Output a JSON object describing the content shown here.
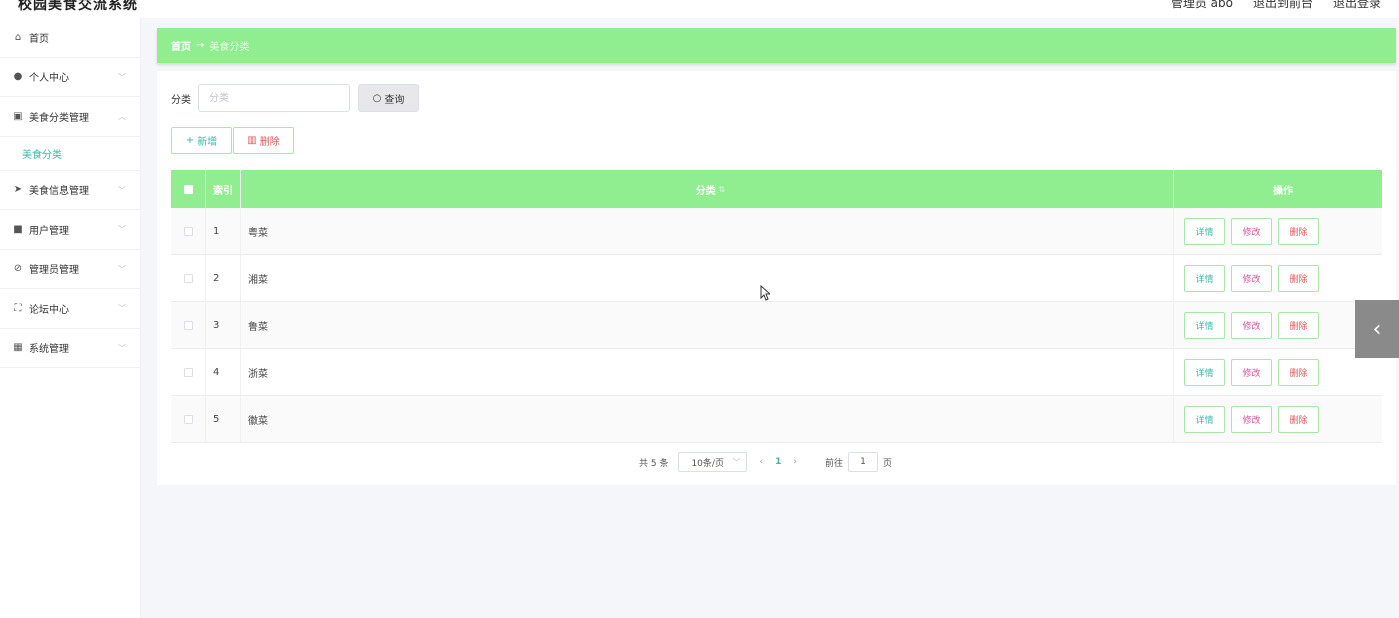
{
  "header": {
    "app_title": "校园美食交流系统",
    "admin_label": "管理员 abo",
    "back_to_front": "退出到前台",
    "logout": "退出登录"
  },
  "sidebar": {
    "items": [
      {
        "label": "首页",
        "icon": "home-icon"
      },
      {
        "label": "个人中心",
        "icon": "user-icon"
      },
      {
        "label": "美食分类管理",
        "icon": "clipboard-icon"
      },
      {
        "label": "美食信息管理",
        "icon": "send-icon"
      },
      {
        "label": "用户管理",
        "icon": "users-icon"
      },
      {
        "label": "管理员管理",
        "icon": "help-circle-icon"
      },
      {
        "label": "论坛中心",
        "icon": "frame-icon"
      },
      {
        "label": "系统管理",
        "icon": "grid-icon"
      }
    ],
    "active_sub": "美食分类"
  },
  "breadcrumb": {
    "home": "首页",
    "arrow": "→",
    "current": "美食分类"
  },
  "search": {
    "label": "分类",
    "placeholder": "分类",
    "query_label": "查询"
  },
  "actions": {
    "add_label": "新增",
    "delete_label": "删除"
  },
  "table": {
    "headers": {
      "index": "索引",
      "category": "分类",
      "operation": "操作"
    },
    "rows": [
      {
        "index": "1",
        "category": "粤菜"
      },
      {
        "index": "2",
        "category": "湘菜"
      },
      {
        "index": "3",
        "category": "鲁菜"
      },
      {
        "index": "4",
        "category": "浙菜"
      },
      {
        "index": "5",
        "category": "徽菜"
      }
    ],
    "op_labels": {
      "detail": "详情",
      "edit": "修改",
      "delete": "删除"
    }
  },
  "pagination": {
    "total": "共 5 条",
    "page_size": "10条/页",
    "current_page": "1",
    "goto_label": "前往",
    "goto_value": "1",
    "page_unit": "页"
  },
  "colors": {
    "accent_green": "#90ee90",
    "teal": "#3bb8a8",
    "pink": "#d9509a",
    "red": "#e05a5a"
  }
}
